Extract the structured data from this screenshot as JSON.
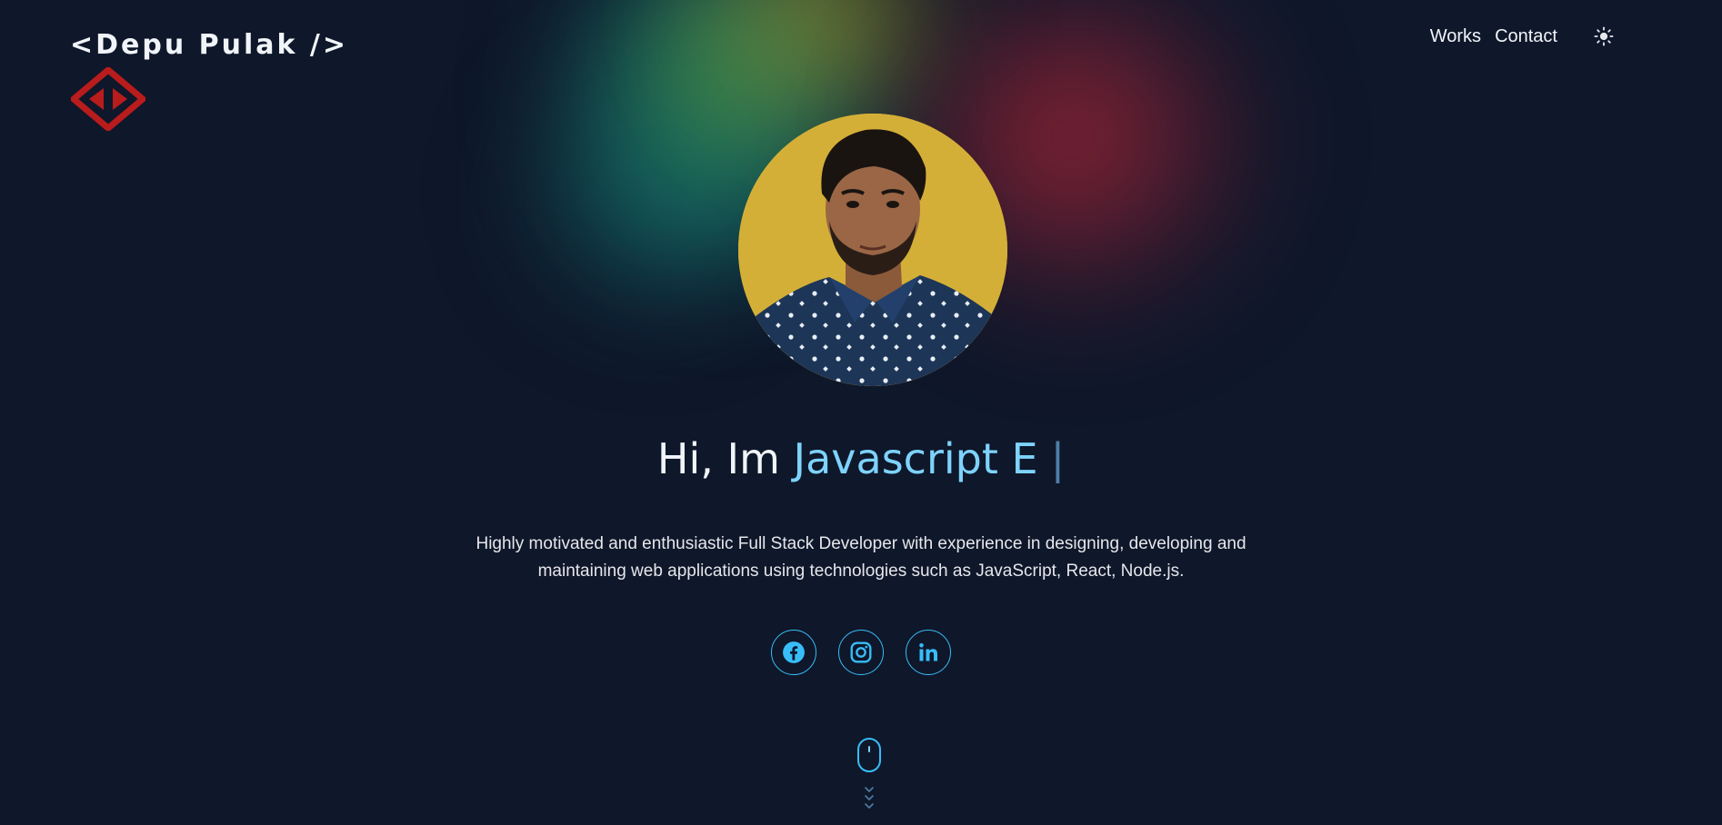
{
  "header": {
    "logo_text": "<Depu Pulak />"
  },
  "nav": {
    "items": [
      {
        "label": "Works"
      },
      {
        "label": "Contact"
      }
    ],
    "theme_icon": "sun-icon"
  },
  "hero": {
    "greeting": "Hi, Im ",
    "role_typed": "Javascript E",
    "cursor": "|",
    "bio_line1": "Highly motivated and enthusiastic Full Stack Developer with experience in designing, developing and",
    "bio_line2": "maintaining web applications using technologies such as JavaScript, React, Node.js.",
    "avatar_icon": "profile-photo"
  },
  "socials": [
    {
      "icon": "facebook-icon"
    },
    {
      "icon": "instagram-icon"
    },
    {
      "icon": "linkedin-icon"
    }
  ],
  "scroll_hint": {
    "icon": "mouse-scroll-icon"
  },
  "colors": {
    "background": "#0f172a",
    "accent": "#38bdf8",
    "accent_light": "#7dd3fc",
    "logo_red": "#b91c1c",
    "avatar_bg": "#d4af37"
  }
}
